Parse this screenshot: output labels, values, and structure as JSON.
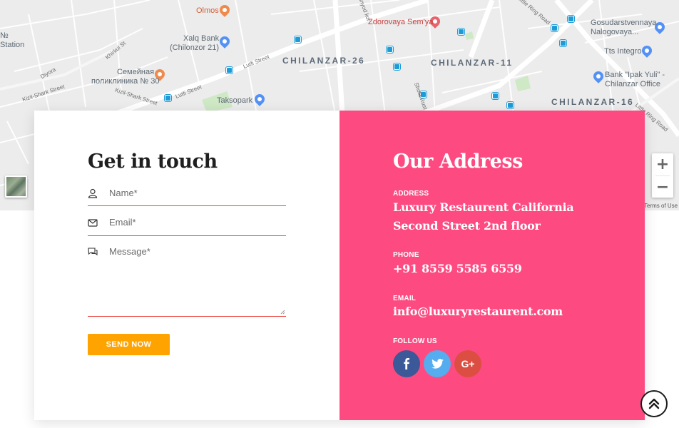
{
  "map": {
    "districts": [
      "CHILANZAR-26",
      "CHILANZAR-11",
      "CHILANZAR-16"
    ],
    "pois": {
      "olmos": "Olmos",
      "zdorovaya": "Zdorovaya Sem'ya",
      "gosudarstvennaya": [
        "Gosudarstvennaya",
        "Nalogovaya..."
      ],
      "xalq_bank": [
        "Xalq Bank",
        "(Chilonzor 21)"
      ],
      "tts_integro": "Tts Integro",
      "semeynaya": [
        "Семейная",
        "поликлиника № 30"
      ],
      "bank_ipak": [
        "Bank \"Ipak Yuli\" -",
        "Chilanzar Office"
      ],
      "taksopark": "Taksopark",
      "station": [
        "№",
        "Station"
      ]
    },
    "streets": {
      "lutfi_1": "Lutfi Street",
      "lutfi_2": "Lutfi Street",
      "little_ring_1": "Little Ring Road",
      "little_ring_2": "Little Ring Road",
      "kizil_shark_1": "Kizil-Shark Street",
      "kizil_shark_2": "Kizil-Shark Street",
      "diyora": "Diyora",
      "khirkul": "Khirkul St",
      "bunyod": "Bunyod kor",
      "shota": "Shota Rust"
    },
    "zoom_in": "+",
    "zoom_out": "−",
    "terms": "Terms of Use"
  },
  "contact_form": {
    "title": "Get in touch",
    "name_placeholder": "Name*",
    "email_placeholder": "Email*",
    "message_placeholder": "Message*",
    "submit_label": "SEND NOW"
  },
  "address": {
    "title": "Our Address",
    "address_label": "ADDRESS",
    "address_line1": "Luxury Restaurent California",
    "address_line2": "Second Street 2nd floor",
    "phone_label": "PHONE",
    "phone": "+91 8559 5585 6559",
    "email_label": "EMAIL",
    "email": "info@luxuryrestaurent.com",
    "follow_label": "FOLLOW US",
    "socials": [
      {
        "name": "facebook",
        "glyph": "f",
        "color": "#3b5998"
      },
      {
        "name": "twitter",
        "glyph": "twitter",
        "color": "#55acee"
      },
      {
        "name": "google-plus",
        "glyph": "G+",
        "color": "#dc4e41"
      }
    ]
  },
  "colors": {
    "accent_pink": "#fd4b82",
    "button_orange": "#ffa300",
    "field_underline": "#e8463f"
  }
}
